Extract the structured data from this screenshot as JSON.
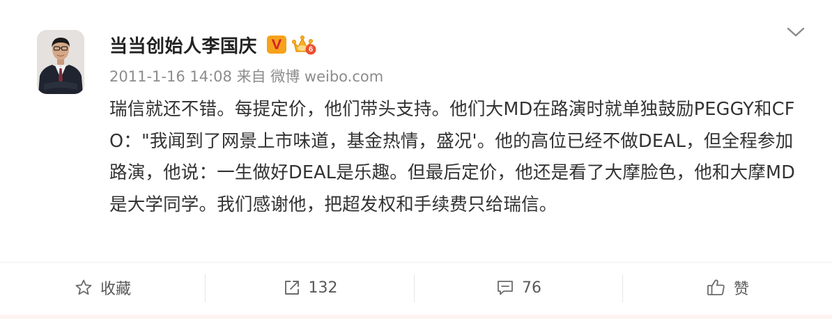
{
  "post": {
    "author": {
      "name": "当当创始人李国庆",
      "verified_badge": "V",
      "verified_icon": "verified-v-icon",
      "membership_icon": "crown-level-icon",
      "membership_level": "6"
    },
    "meta": {
      "timestamp": "2011-1-16 14:08",
      "source_prefix": "来自",
      "source": "微博 weibo.com"
    },
    "text": "瑞信就还不错。每提定价，他们带头支持。他们大MD在路演时就单独鼓励PEGGY和CFO：\"我闻到了网景上市味道，基金热情，盛况'。他的高位已经不做DEAL，但全程参加路演，他说：一生做好DEAL是乐趣。但最后定价，他还是看了大摩脸色，他和大摩MD是大学同学。我们感谢他，把超发权和手续费只给瑞信。",
    "more_icon": "chevron-down-icon"
  },
  "actions": {
    "favorite": {
      "label": "收藏",
      "icon": "star-outline-icon"
    },
    "repost": {
      "count": "132",
      "icon": "share-arrow-icon"
    },
    "comment": {
      "count": "76",
      "icon": "comment-bubble-icon"
    },
    "like": {
      "label": "赞",
      "icon": "thumbs-up-icon"
    }
  },
  "colors": {
    "text": "#333333",
    "meta": "#8c8c8c",
    "action": "#595959",
    "badge_orange": "#f6a21b",
    "badge_red": "#d4202a"
  }
}
